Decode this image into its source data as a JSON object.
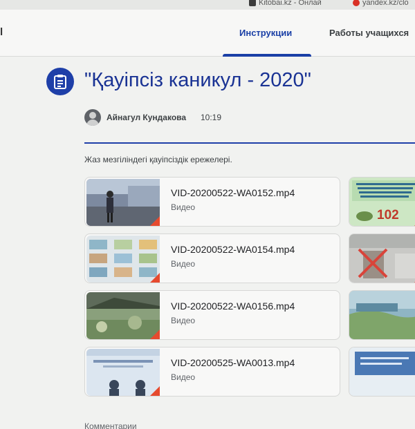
{
  "browser": {
    "bookmarks": [
      {
        "label": "Kitobai.kz - Онлай",
        "icon": "kitobai-icon",
        "color": "#3b3b3b"
      },
      {
        "label": "yandex.kz/clo",
        "icon": "yandex-icon",
        "color": "#d93025"
      }
    ]
  },
  "topbar": {
    "left_fragment": "l",
    "tabs": [
      {
        "label": "Инструкции",
        "active": true
      },
      {
        "label": "Работы учащихся",
        "active": false
      }
    ]
  },
  "assignment": {
    "icon": "assignment-icon",
    "title": "\"Қауіпсіз каникул - 2020\"",
    "author": "Айнагул Кундакова",
    "time": "10:19",
    "description": "Жаз мезгіліндегі қауіпсіздік ережелері."
  },
  "attachments": [
    {
      "name": "VID-20200522-WA0152.mp4",
      "type": "Видео"
    },
    {
      "name": "VID-20200522-WA0154.mp4",
      "type": "Видео"
    },
    {
      "name": "VID-20200522-WA0156.mp4",
      "type": "Видео"
    },
    {
      "name": "VID-20200525-WA0013.mp4",
      "type": "Видео"
    }
  ],
  "right_attachments": {
    "first_badge": "102"
  },
  "comments_label": "Комментарии",
  "colors": {
    "accent": "#1e3fa8",
    "video_corner": "#e64a2e"
  }
}
